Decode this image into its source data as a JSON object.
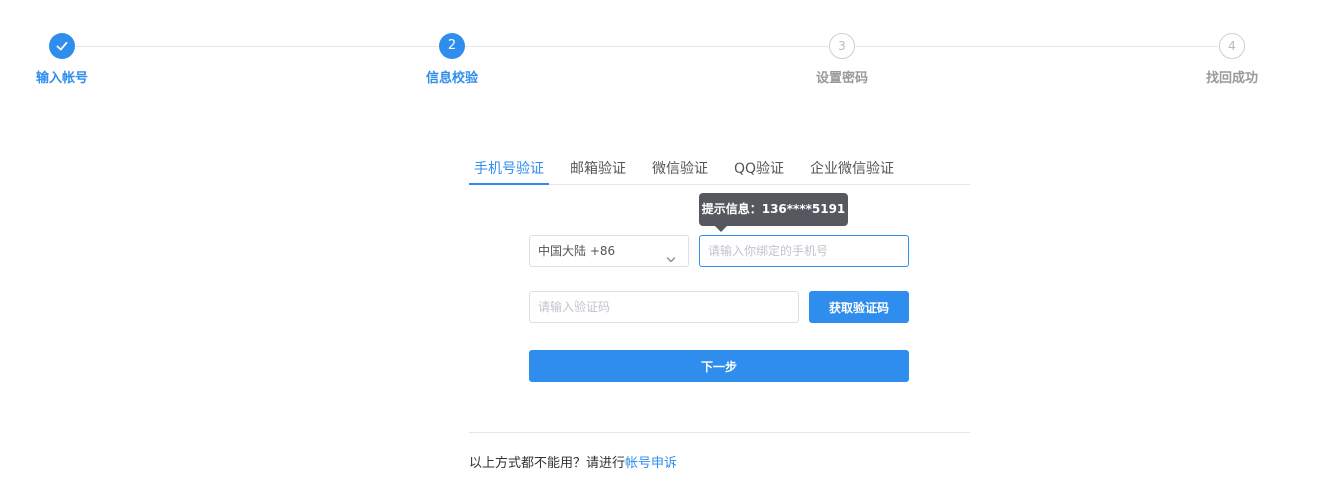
{
  "steps": [
    {
      "number": "1",
      "label": "输入帐号",
      "state": "done",
      "icon": "check-icon"
    },
    {
      "number": "2",
      "label": "信息校验",
      "state": "active"
    },
    {
      "number": "3",
      "label": "设置密码",
      "state": "pending"
    },
    {
      "number": "4",
      "label": "找回成功",
      "state": "pending"
    }
  ],
  "tabs": [
    {
      "label": "手机号验证",
      "active": true
    },
    {
      "label": "邮箱验证",
      "active": false
    },
    {
      "label": "微信验证",
      "active": false
    },
    {
      "label": "QQ验证",
      "active": false
    },
    {
      "label": "企业微信验证",
      "active": false
    }
  ],
  "tooltip": {
    "text": "提示信息：136****5191"
  },
  "form": {
    "country_select": {
      "value": "中国大陆 +86",
      "icon": "chevron-down-icon"
    },
    "phone_input": {
      "value": "",
      "placeholder": "请输入你绑定的手机号"
    },
    "code_input": {
      "value": "",
      "placeholder": "请输入验证码"
    },
    "get_code_label": "获取验证码",
    "next_label": "下一步"
  },
  "footer": {
    "text": "以上方式都不能用？请进行",
    "link_label": "帐号申诉"
  },
  "colors": {
    "accent": "#2e8ded",
    "tooltip_bg": "#55595f",
    "muted": "#999999",
    "border": "#dcdfe6"
  }
}
